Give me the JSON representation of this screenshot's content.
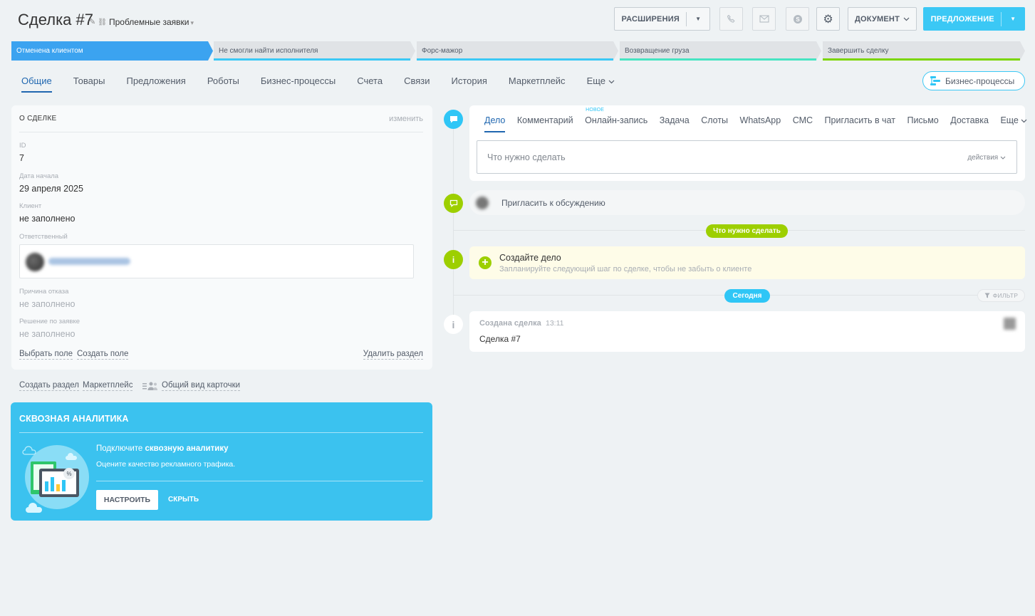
{
  "header": {
    "title": "Сделка #7",
    "category": "Проблемные заявки",
    "extensions_label": "РАСШИРЕНИЯ",
    "document_label": "ДОКУМЕНТ",
    "proposal_label": "ПРЕДЛОЖЕНИЕ"
  },
  "stages": [
    {
      "label": "Отменена клиентом",
      "color": "#3ba3f0",
      "active": true
    },
    {
      "label": "Не смогли найти исполнителя",
      "color": "#3bc8f5",
      "active": false
    },
    {
      "label": "Форс-мажор",
      "color": "#3bc8f5",
      "active": false
    },
    {
      "label": "Возвращение груза",
      "color": "#47e4c2",
      "active": false
    },
    {
      "label": "Завершить сделку",
      "color": "#7bd500",
      "active": false
    }
  ],
  "tabs": [
    "Общие",
    "Товары",
    "Предложения",
    "Роботы",
    "Бизнес-процессы",
    "Счета",
    "Связи",
    "История",
    "Маркетплейс",
    "Еще"
  ],
  "bp_button": "Бизнес-процессы",
  "deal_card": {
    "heading": "О СДЕЛКЕ",
    "edit": "изменить",
    "fields": {
      "id_label": "ID",
      "id_value": "7",
      "start_label": "Дата начала",
      "start_value": "29 апреля 2025",
      "client_label": "Клиент",
      "client_value": "не заполнено",
      "responsible_label": "Ответственный",
      "reason_label": "Причина отказа",
      "reason_value": "не заполнено",
      "decision_label": "Решение по заявке",
      "decision_value": "не заполнено"
    },
    "links": {
      "choose_field": "Выбрать поле",
      "create_field": "Создать поле",
      "delete_section": "Удалить раздел"
    }
  },
  "below_links": {
    "create_section": "Создать раздел",
    "marketplace": "Маркетплейс",
    "common_view": "Общий вид карточки"
  },
  "analytics": {
    "title": "СКВОЗНАЯ АНАЛИТИКА",
    "line1_prefix": "Подключите",
    "line1_bold": "сквозную аналитику",
    "line2": "Оцените качество рекламного трафика.",
    "setup_label": "НАСТРОИТЬ",
    "hide_label": "СКРЫТЬ"
  },
  "activity": {
    "tabs": [
      "Дело",
      "Комментарий",
      "Онлайн-запись",
      "Задача",
      "Слоты",
      "WhatsApp",
      "СМС",
      "Пригласить в чат",
      "Письмо",
      "Доставка",
      "Еще"
    ],
    "new_badge": "НОВОЕ",
    "placeholder": "Что нужно сделать",
    "actions": "действия"
  },
  "timeline": {
    "invite": "Пригласить к обсуждению",
    "todo_pill": "Что нужно сделать",
    "create_title": "Создайте дело",
    "create_desc": "Запланируйте следующий шаг по сделке, чтобы не забыть о клиенте",
    "today_pill": "Сегодня",
    "filter": "ФИЛЬТР",
    "created_title": "Создана сделка",
    "created_time": "13:11",
    "created_body": "Сделка #7"
  },
  "colors": {
    "accent": "#3bc8f5",
    "link_active": "#2067b0",
    "green": "#9dcf00"
  }
}
